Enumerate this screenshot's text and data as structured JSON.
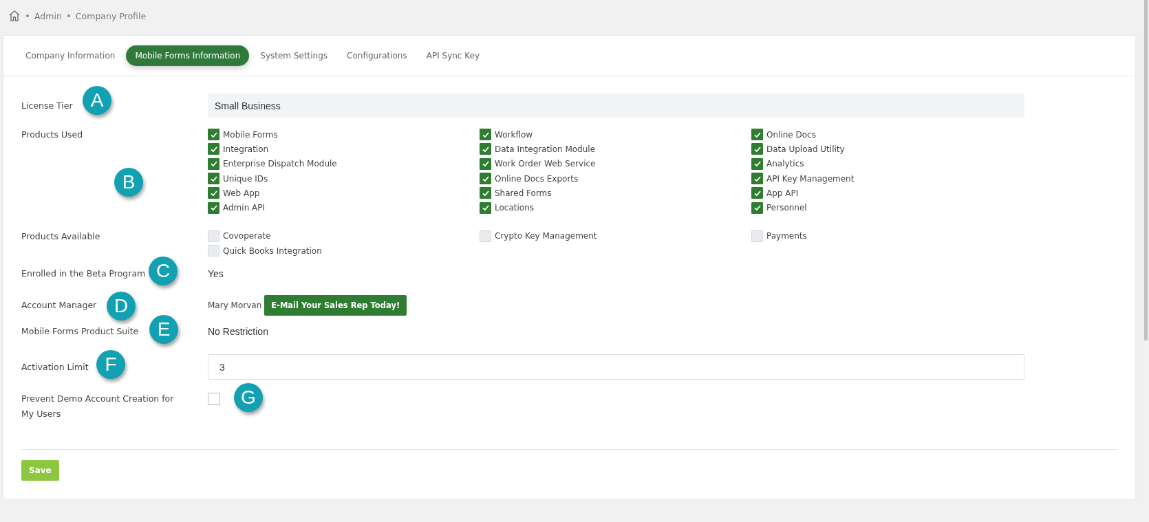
{
  "breadcrumb": [
    "Admin",
    "Company Profile"
  ],
  "tabs": [
    {
      "label": "Company Information",
      "selected": false
    },
    {
      "label": "Mobile Forms Information",
      "selected": true
    },
    {
      "label": "System Settings",
      "selected": false
    },
    {
      "label": "Configurations",
      "selected": false
    },
    {
      "label": "API Sync Key",
      "selected": false
    }
  ],
  "form": [
    {
      "kind": "field",
      "label": "License Tier",
      "value": "Small Business",
      "readonly": true,
      "callout": "A"
    },
    {
      "kind": "checks",
      "label": "Products Used",
      "callout": "B",
      "items": [
        {
          "label": "Mobile Forms",
          "checked": true
        },
        {
          "label": "Workflow",
          "checked": true
        },
        {
          "label": "Online Docs",
          "checked": true
        },
        {
          "label": "Integration",
          "checked": true
        },
        {
          "label": "Data Integration Module",
          "checked": true
        },
        {
          "label": "Data Upload Utility",
          "checked": true
        },
        {
          "label": "Enterprise Dispatch Module",
          "checked": true
        },
        {
          "label": "Work Order Web Service",
          "checked": true
        },
        {
          "label": "Analytics",
          "checked": true
        },
        {
          "label": "Unique IDs",
          "checked": true
        },
        {
          "label": "Online Docs Exports",
          "checked": true
        },
        {
          "label": "API Key Management",
          "checked": true
        },
        {
          "label": "Web App",
          "checked": true
        },
        {
          "label": "Shared Forms",
          "checked": true
        },
        {
          "label": "App API",
          "checked": true
        },
        {
          "label": "Admin API",
          "checked": true
        },
        {
          "label": "Locations",
          "checked": true
        },
        {
          "label": "Personnel",
          "checked": true
        }
      ]
    },
    {
      "kind": "checks",
      "label": "Products Available",
      "items": [
        {
          "label": "Covoperate",
          "checked": false
        },
        {
          "label": "Crypto Key Management",
          "checked": false
        },
        {
          "label": "Payments",
          "checked": false
        },
        {
          "label": "Quick Books Integration",
          "checked": false
        }
      ]
    },
    {
      "kind": "text",
      "label": "Enrolled in the Beta Program",
      "value": "Yes",
      "callout": "C"
    },
    {
      "kind": "manager",
      "label": "Account Manager",
      "value": "Mary Morvan",
      "button": "E-Mail Your Sales Rep Today!",
      "callout": "D"
    },
    {
      "kind": "text",
      "label": "Mobile Forms Product Suite",
      "value": "No Restriction",
      "callout": "E"
    },
    {
      "kind": "field",
      "label": "Activation Limit",
      "value": "3",
      "readonly": false,
      "callout": "F"
    },
    {
      "kind": "checkbox",
      "label": "Prevent Demo Account Creation for My Users",
      "checked": false,
      "callout": "G"
    }
  ],
  "save_button": "Save"
}
